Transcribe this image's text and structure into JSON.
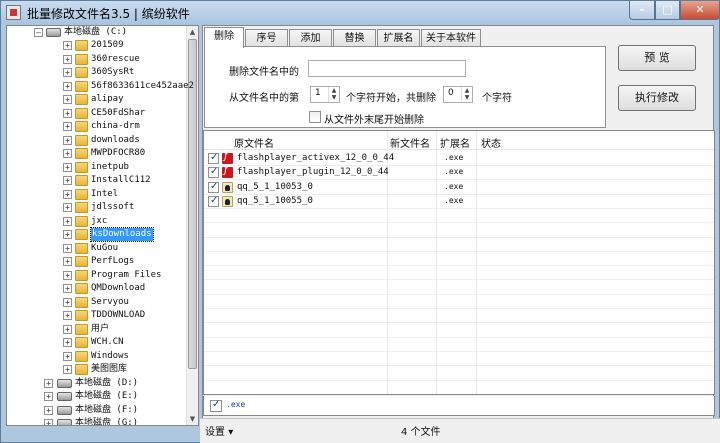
{
  "window": {
    "title": "批量修改文件名3.5 | 缤纷软件",
    "min_glyph": "–",
    "max_glyph": "□",
    "close_glyph": "✕"
  },
  "tree": {
    "expand_glyph": "+",
    "collapse_glyph": "–",
    "root": "本地磁盘 (C:)",
    "folders": [
      "201509",
      "360rescue",
      "360SysRt",
      "56f8633611ce452aae2",
      "alipay",
      "CE50FdShar",
      "china-drm",
      "downloads",
      "MWPDFOCR80",
      "inetpub",
      "InstallC112",
      "Intel",
      "jdlssoft",
      "jxc",
      "ksDownloads",
      "KuGou",
      "PerfLogs",
      "Program Files",
      "QMDownload",
      "Servyou",
      "TDDOWNLOAD",
      "用户",
      "WCH.CN",
      "Windows",
      "美图图库"
    ],
    "selected": "ksDownloads",
    "drives": [
      "本地磁盘 (D:)",
      "本地磁盘 (E:)",
      "本地磁盘 (F:)",
      "本地磁盘 (G:)"
    ],
    "scroll_up": "▲",
    "scroll_down": "▼"
  },
  "tabs": [
    "删除",
    "序号",
    "添加",
    "替换",
    "扩展名",
    "关于本软件"
  ],
  "active_tab": "删除",
  "delete_panel": {
    "delete_in_name_label": "删除文件名中的",
    "delete_in_name_value": "",
    "from_position_label": "从文件名中的第",
    "start_value": "1",
    "start_suffix": "个字符开始，共删除",
    "count_value": "0",
    "count_suffix": "个字符",
    "from_end_label": "从文件外末尾开始删除",
    "spin_up": "▲",
    "spin_down": "▼"
  },
  "buttons": {
    "preview": "预  览",
    "execute": "执行修改"
  },
  "table": {
    "headers": {
      "original": "原文件名",
      "new": "新文件名",
      "ext": "扩展名",
      "status": "状态"
    },
    "rows": [
      {
        "name": "flashplayer_activex_12_0_0_44",
        "ext": ".exe",
        "icon": "flash-icon",
        "checked": true
      },
      {
        "name": "flashplayer_plugin_12_0_0_44",
        "ext": ".exe",
        "icon": "flash-icon",
        "checked": true
      },
      {
        "name": "qq_5_1_10053_0",
        "ext": ".exe",
        "icon": "qq-icon",
        "checked": true
      },
      {
        "name": "qq_5_1_10055_0",
        "ext": ".exe",
        "icon": "qq-icon",
        "checked": true
      }
    ]
  },
  "filter": {
    "ext": ".exe",
    "checked": true
  },
  "status": {
    "settings": "设置",
    "settings_arrow": "▾",
    "file_count": "4 个文件"
  }
}
